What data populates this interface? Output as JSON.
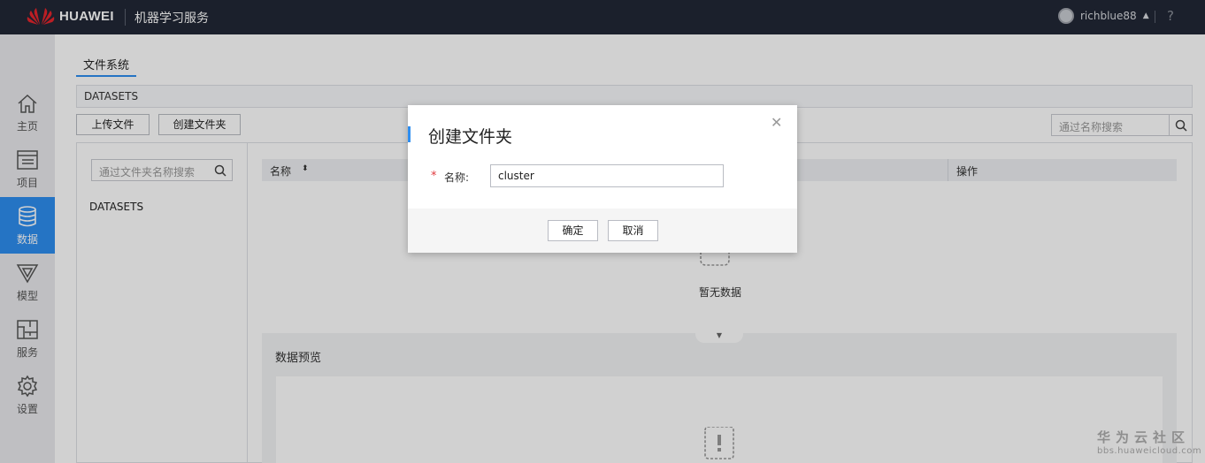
{
  "header": {
    "brand": "HUAWEI",
    "service": "机器学习服务",
    "username": "richblue88",
    "help": "?"
  },
  "sidebar": {
    "items": [
      {
        "label": "主页",
        "icon": "home-icon"
      },
      {
        "label": "项目",
        "icon": "project-icon"
      },
      {
        "label": "数据",
        "icon": "database-icon",
        "active": true
      },
      {
        "label": "模型",
        "icon": "model-icon"
      },
      {
        "label": "服务",
        "icon": "service-icon"
      },
      {
        "label": "设置",
        "icon": "gear-icon"
      }
    ]
  },
  "main": {
    "tab": "文件系统",
    "path": "DATASETS",
    "upload_button": "上传文件",
    "create_folder_button": "创建文件夹",
    "search_placeholder": "通过名称搜索",
    "folder_search_placeholder": "通过文件夹名称搜索",
    "folders": [
      "DATASETS"
    ],
    "table": {
      "columns": [
        "名称",
        "操作"
      ]
    },
    "empty_text": "暂无数据",
    "preview_title": "数据预览"
  },
  "modal": {
    "title": "创建文件夹",
    "field_label": "名称:",
    "required_mark": "*",
    "field_value": "cluster",
    "confirm": "确定",
    "cancel": "取消"
  },
  "watermark": {
    "line1": "华为云社区",
    "line2": "bbs.huaweicloud.com"
  },
  "colors": {
    "topbar": "#222836",
    "accent": "#2e8ef0",
    "required": "#e0393e"
  }
}
